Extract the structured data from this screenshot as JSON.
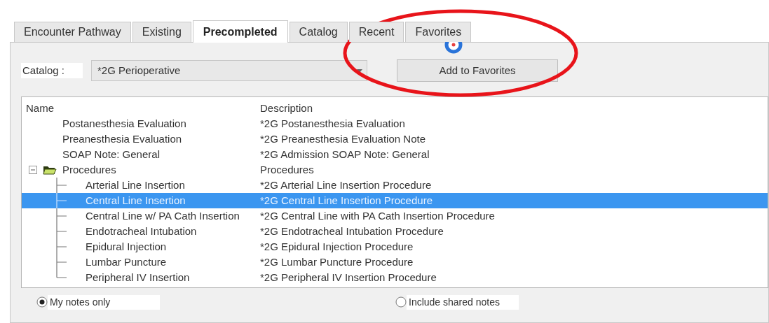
{
  "tabs": [
    {
      "label": "Encounter Pathway",
      "selected": false
    },
    {
      "label": "Existing",
      "selected": false
    },
    {
      "label": "Precompleted",
      "selected": true
    },
    {
      "label": "Catalog",
      "selected": false
    },
    {
      "label": "Recent",
      "selected": false
    },
    {
      "label": "Favorites",
      "selected": false
    }
  ],
  "catalog": {
    "label": "Catalog :",
    "value": "*2G Perioperative"
  },
  "add_button": "Add to Favorites",
  "list": {
    "columns": [
      "Name",
      "Description"
    ],
    "rows": [
      {
        "name": "Postanesthesia Evaluation",
        "description": "*2G Postanesthesia Evaluation",
        "selected": false
      },
      {
        "name": "Preanesthesia Evaluation",
        "description": "*2G Preanesthesia Evaluation Note",
        "selected": false
      },
      {
        "name": "SOAP Note: General",
        "description": "*2G Admission SOAP Note: General",
        "selected": false
      },
      {
        "name": "Procedures",
        "description": "Procedures",
        "selected": false,
        "expanded": true,
        "children": [
          {
            "name": "Arterial Line Insertion",
            "description": "*2G Arterial Line Insertion Procedure",
            "selected": false
          },
          {
            "name": "Central Line Insertion",
            "description": "*2G Central Line Insertion Procedure",
            "selected": true
          },
          {
            "name": "Central Line w/ PA Cath Insertion",
            "description": "*2G Central Line with PA Cath Insertion Procedure",
            "selected": false
          },
          {
            "name": "Endotracheal Intubation",
            "description": "*2G Endotracheal Intubation Procedure",
            "selected": false
          },
          {
            "name": "Epidural Injection",
            "description": "*2G Epidural Injection Procedure",
            "selected": false
          },
          {
            "name": "Lumbar Puncture",
            "description": "*2G Lumbar Puncture Procedure",
            "selected": false
          },
          {
            "name": "Peripheral IV Insertion",
            "description": "*2G Peripheral IV Insertion Procedure",
            "selected": false
          }
        ]
      }
    ]
  },
  "radios": [
    {
      "label": "My notes only",
      "selected": true
    },
    {
      "label": "Include shared notes",
      "selected": false
    }
  ]
}
